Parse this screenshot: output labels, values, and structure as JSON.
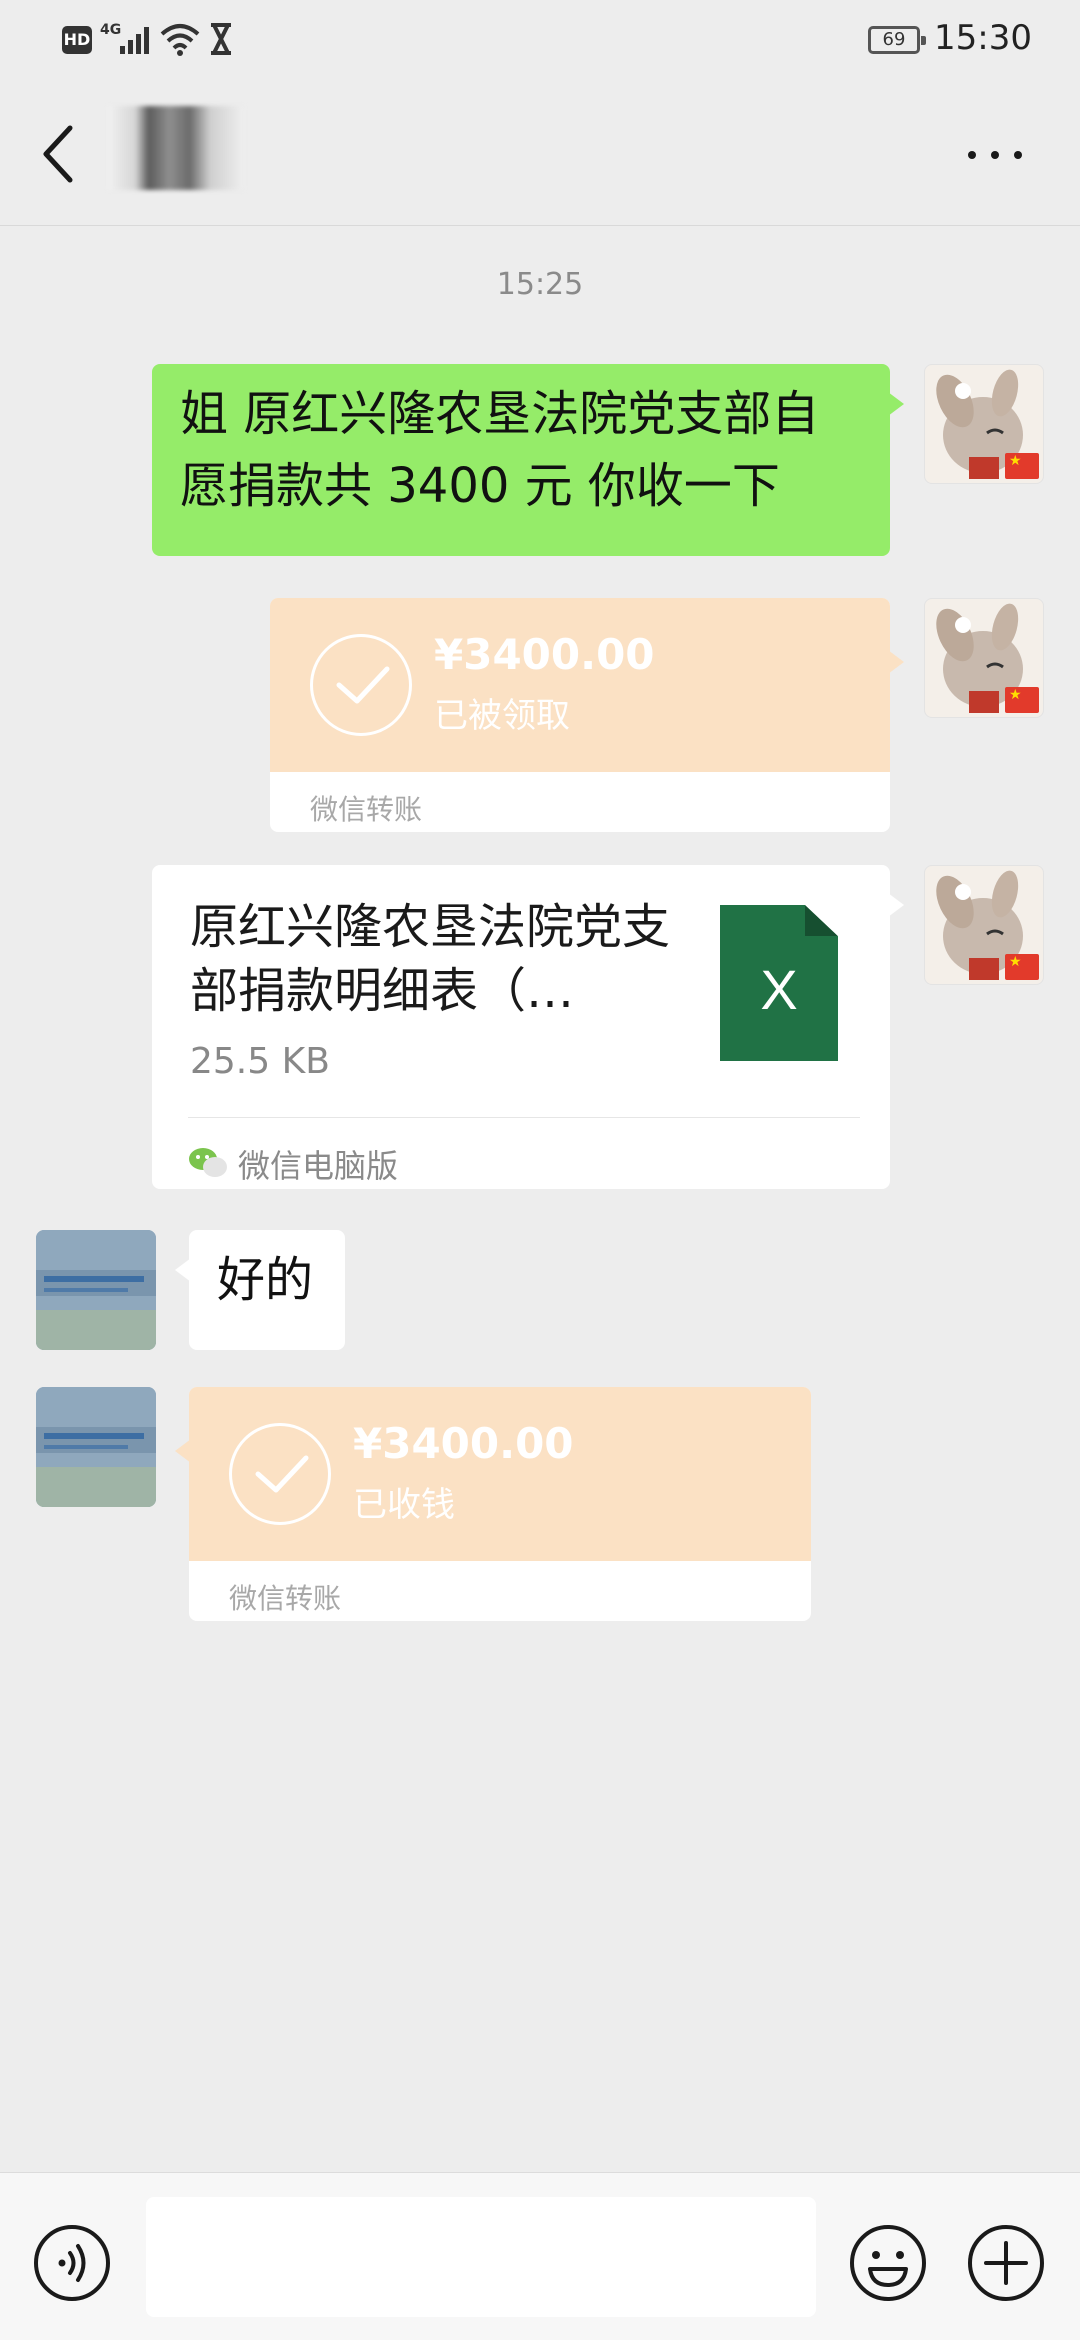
{
  "status_bar": {
    "hd": "HD",
    "network": "4G",
    "battery": "69",
    "time": "15:30"
  },
  "header": {
    "title": ""
  },
  "chat": {
    "timestamp": "15:25",
    "messages": [
      {
        "type": "text",
        "from": "self",
        "text": "姐 原红兴隆农垦法院党支部自愿捐款共 3400 元 你收一下"
      },
      {
        "type": "transfer",
        "from": "self",
        "amount": "¥3400.00",
        "status": "已被领取",
        "footer": "微信转账"
      },
      {
        "type": "file",
        "from": "self",
        "name": "原红兴隆农垦法院党支部捐款明细表（…",
        "size": "25.5 KB",
        "icon_letter": "X",
        "source": "微信电脑版"
      },
      {
        "type": "text",
        "from": "other",
        "text": "好的"
      },
      {
        "type": "transfer",
        "from": "other",
        "amount": "¥3400.00",
        "status": "已收钱",
        "footer": "微信转账"
      }
    ]
  },
  "input_bar": {
    "value": ""
  },
  "colors": {
    "background": "#ededed",
    "self_bubble": "#95ec69",
    "transfer": "#fbe1c4",
    "excel_green": "#207245"
  },
  "icons": [
    "back-arrow-icon",
    "more-icon",
    "voice-icon",
    "emoji-icon",
    "plus-icon",
    "check-icon",
    "excel-file-icon",
    "wechat-icon"
  ]
}
